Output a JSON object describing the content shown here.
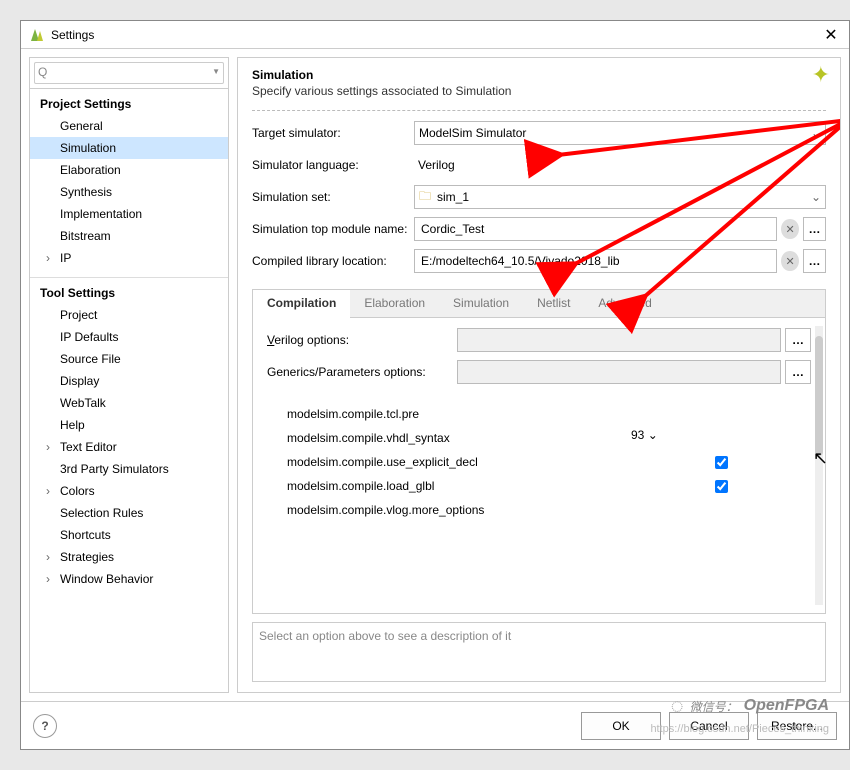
{
  "window": {
    "title": "Settings"
  },
  "search": {
    "placeholder": ""
  },
  "sidebar": {
    "group1": "Project Settings",
    "items1": [
      "General",
      "Simulation",
      "Elaboration",
      "Synthesis",
      "Implementation",
      "Bitstream",
      "IP"
    ],
    "group2": "Tool Settings",
    "items2": [
      "Project",
      "IP Defaults",
      "Source File",
      "Display",
      "WebTalk",
      "Help",
      "Text Editor",
      "3rd Party Simulators",
      "Colors",
      "Selection Rules",
      "Shortcuts",
      "Strategies",
      "Window Behavior"
    ]
  },
  "page": {
    "heading": "Simulation",
    "subheading": "Specify various settings associated to Simulation",
    "rows": {
      "target_sim_lbl": "Target simulator:",
      "target_sim_val": "ModelSim Simulator",
      "sim_lang_lbl": "Simulator language:",
      "sim_lang_val": "Verilog",
      "sim_set_lbl": "Simulation set:",
      "sim_set_val": "sim_1",
      "top_mod_lbl": "Simulation top module name:",
      "top_mod_val": "Cordic_Test",
      "lib_loc_lbl": "Compiled library location:",
      "lib_loc_val": "E:/modeltech64_10.5/Vivado2018_lib"
    },
    "tabs": [
      "Compilation",
      "Elaboration",
      "Simulation",
      "Netlist",
      "Advanced"
    ],
    "compilation": {
      "verilog_opts_lbl": "Verilog options:",
      "generics_lbl": "Generics/Parameters options:",
      "prop1": "modelsim.compile.tcl.pre",
      "prop2": "modelsim.compile.vhdl_syntax",
      "prop2_val": "93",
      "prop3": "modelsim.compile.use_explicit_decl",
      "prop4": "modelsim.compile.load_glbl",
      "prop5": "modelsim.compile.vlog.more_options"
    },
    "desc_placeholder": "Select an option above to see a description of it"
  },
  "footer": {
    "ok": "OK",
    "cancel": "Cancel",
    "restore": "Restore..."
  },
  "watermark": {
    "label": "微信号：",
    "name": "OpenFPGA",
    "sub": "https://blog.csdn.net/Pieces_thinking"
  }
}
